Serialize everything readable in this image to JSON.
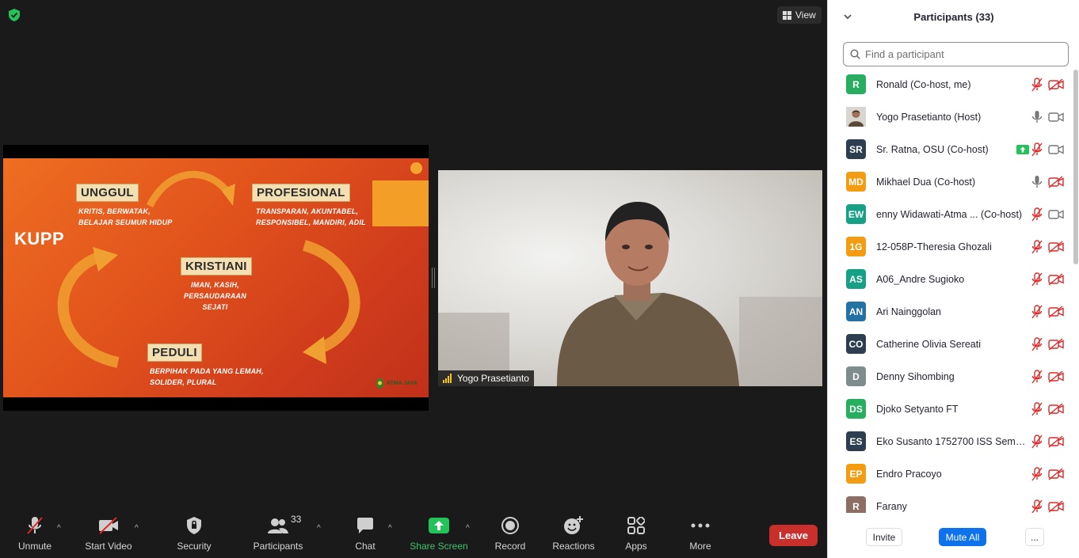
{
  "top": {
    "view_label": "View"
  },
  "slide": {
    "title": "KUPP",
    "unggul": {
      "label": "UNGGUL",
      "sub": [
        "KRITIS, BERWATAK,",
        "BELAJAR SEUMUR HIDUP"
      ]
    },
    "profesional": {
      "label": "PROFESIONAL",
      "sub": [
        "TRANSPARAN, AKUNTABEL,",
        "RESPONSIBEL, MANDIRI, ADIL"
      ]
    },
    "kristiani": {
      "label": "KRISTIANI",
      "sub": [
        "IMAN, KASIH,",
        "PERSAUDARAAN",
        "SEJATI"
      ]
    },
    "peduli": {
      "label": "PEDULI",
      "sub": [
        "BERPIHAK PADA YANG LEMAH,",
        "SOLIDER, PLURAL"
      ]
    },
    "logo_text": "ATMA JAYA"
  },
  "video": {
    "name": "Yogo Prasetianto"
  },
  "toolbar": {
    "unmute": "Unmute",
    "start_video": "Start Video",
    "security": "Security",
    "participants": "Participants",
    "participants_count": "33",
    "chat": "Chat",
    "share_screen": "Share Screen",
    "record": "Record",
    "reactions": "Reactions",
    "apps": "Apps",
    "more": "More",
    "leave": "Leave"
  },
  "panel": {
    "title": "Participants (33)",
    "search_placeholder": "Find a participant",
    "participants": [
      {
        "initials": "R",
        "color": "#27ae60",
        "name": "Ronald (Co-host, me)",
        "mic": "muted",
        "video": "off"
      },
      {
        "initials": "",
        "color": "#8a7f70",
        "name": "Yogo Prasetianto (Host)",
        "mic": "on",
        "video": "on",
        "photo": true
      },
      {
        "initials": "SR",
        "color": "#2c3e50",
        "name": "Sr. Ratna, OSU (Co-host)",
        "mic": "share",
        "video": "on"
      },
      {
        "initials": "MD",
        "color": "#f39c12",
        "name": "Mikhael Dua (Co-host)",
        "mic": "on",
        "video": "off"
      },
      {
        "initials": "EW",
        "color": "#16a085",
        "name": "enny Widawati-Atma ... (Co-host)",
        "mic": "muted",
        "video": "on"
      },
      {
        "initials": "1G",
        "color": "#f39c12",
        "name": "12-058P-Theresia Ghozali",
        "mic": "muted",
        "video": "off"
      },
      {
        "initials": "AS",
        "color": "#16a085",
        "name": "A06_Andre Sugioko",
        "mic": "muted",
        "video": "off"
      },
      {
        "initials": "AN",
        "color": "#2471a3",
        "name": "Ari Nainggolan",
        "mic": "muted",
        "video": "off"
      },
      {
        "initials": "CO",
        "color": "#2c3e50",
        "name": "Catherine Olivia Sereati",
        "mic": "muted",
        "video": "off"
      },
      {
        "initials": "D",
        "color": "#7f8c8d",
        "name": "Denny Sihombing",
        "mic": "muted",
        "video": "off"
      },
      {
        "initials": "DS",
        "color": "#27ae60",
        "name": "Djoko Setyanto FT",
        "mic": "muted",
        "video": "off"
      },
      {
        "initials": "ES",
        "color": "#2c3e50",
        "name": "Eko Susanto 1752700 ISS Sema...",
        "mic": "muted",
        "video": "off"
      },
      {
        "initials": "EP",
        "color": "#f39c12",
        "name": "Endro Pracoyo",
        "mic": "muted",
        "video": "off"
      },
      {
        "initials": "R",
        "color": "#8d6e63",
        "name": "Farany",
        "mic": "muted",
        "video": "off"
      }
    ],
    "invite": "Invite",
    "mute_all": "Mute All",
    "more": "..."
  }
}
